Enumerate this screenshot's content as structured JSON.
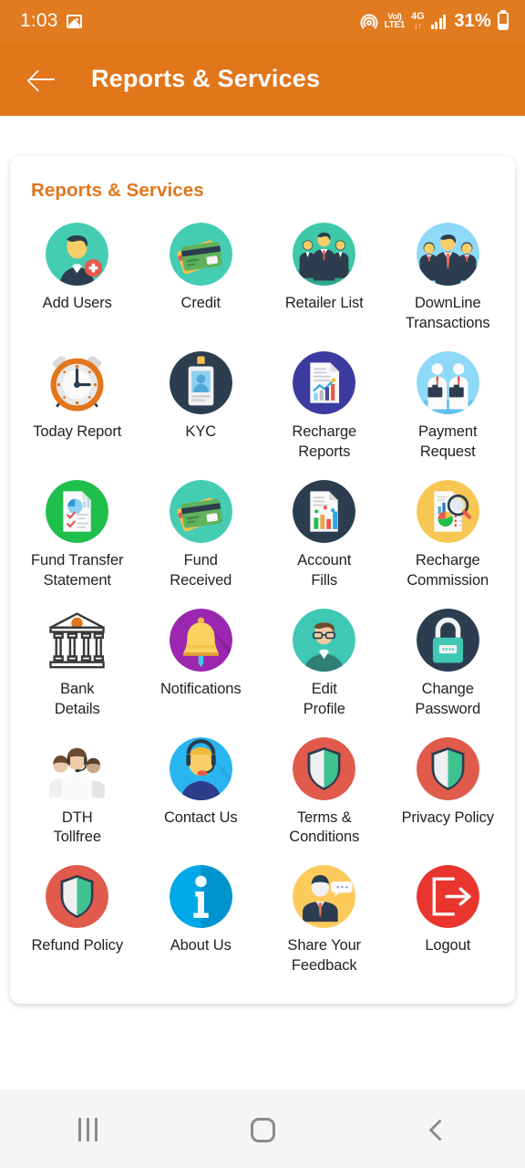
{
  "status_bar": {
    "time": "1:03",
    "gallery_icon": "gallery-icon",
    "cast_icon": "cast-icon",
    "volte_line1": "VoI)",
    "volte_line2": "LTE1",
    "network_type": "4G",
    "network_arrows": "↓↑",
    "signal_icon": "signal-bars-icon",
    "battery_percent": "31%",
    "battery_icon": "battery-icon"
  },
  "app_bar": {
    "back_icon": "back-arrow-icon",
    "title": "Reports & Services"
  },
  "card": {
    "title": "Reports & Services",
    "accent_color": "#E2761B",
    "items": [
      {
        "label": "Add Users",
        "icon": "add-user-icon",
        "bg": "#45CDB4"
      },
      {
        "label": "Credit",
        "icon": "credit-cards-icon",
        "bg": "#45CDB4"
      },
      {
        "label": "Retailer List",
        "icon": "retailer-group-icon",
        "bg": "#3FC8A8"
      },
      {
        "label": "DownLine\nTransactions",
        "icon": "downline-group-icon",
        "bg": "#8ED8F8"
      },
      {
        "label": "Today Report",
        "icon": "alarm-clock-icon",
        "bg": "#FFFFFF"
      },
      {
        "label": "KYC",
        "icon": "id-card-icon",
        "bg": "#2B3D4F"
      },
      {
        "label": "Recharge\nReports",
        "icon": "recharge-report-icon",
        "bg": "#3B3BA0"
      },
      {
        "label": "Payment\nRequest",
        "icon": "payment-request-icon",
        "bg": "#8ED8F8"
      },
      {
        "label": "Fund Transfer\nStatement",
        "icon": "fund-transfer-icon",
        "bg": "#1FBF4B"
      },
      {
        "label": "Fund\nReceived",
        "icon": "fund-received-icon",
        "bg": "#45CDB4"
      },
      {
        "label": "Account\nFills",
        "icon": "account-fills-icon",
        "bg": "#2B3D4F"
      },
      {
        "label": "Recharge\nCommission",
        "icon": "recharge-commission-icon",
        "bg": "#F7C košt"
      },
      {
        "label": "Bank\nDetails",
        "icon": "bank-building-icon",
        "bg": "transparent"
      },
      {
        "label": "Notifications",
        "icon": "bell-icon",
        "bg": "#9B27B0"
      },
      {
        "label": "Edit\nProfile",
        "icon": "edit-profile-icon",
        "bg": "#3FC8B4"
      },
      {
        "label": "Change\nPassword",
        "icon": "padlock-icon",
        "bg": "#2B3D4F"
      },
      {
        "label": "DTH\nTollfree",
        "icon": "support-team-icon",
        "bg": "transparent"
      },
      {
        "label": "Contact Us",
        "icon": "headset-agent-icon",
        "bg": "#29B6F0"
      },
      {
        "label": "Terms &\nConditions",
        "icon": "shield-icon",
        "bg": "#E05B4B"
      },
      {
        "label": "Privacy Policy",
        "icon": "shield-icon",
        "bg": "#E05B4B"
      },
      {
        "label": "Refund Policy",
        "icon": "shield-icon",
        "bg": "#E05B4B"
      },
      {
        "label": "About Us",
        "icon": "info-icon",
        "bg": "#00A8E8"
      },
      {
        "label": "Share Your\nFeedback",
        "icon": "feedback-icon",
        "bg": "#FCCB5C"
      },
      {
        "label": "Logout",
        "icon": "logout-icon",
        "bg": "#E8352E"
      }
    ]
  },
  "nav_bar": {
    "recents_icon": "recents-icon",
    "home_icon": "home-icon",
    "back_icon": "back-icon"
  }
}
